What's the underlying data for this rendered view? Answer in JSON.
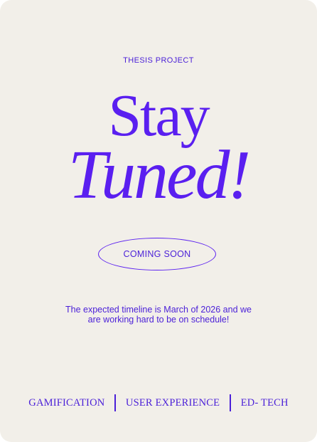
{
  "eyebrow": "THESIS PROJECT",
  "headline": {
    "line1": "Stay",
    "line2": "Tuned!"
  },
  "cta": {
    "label": "COMING SOON"
  },
  "body": {
    "line1": "The expected timeline is March of 2026 and we",
    "line2": "are working hard to be on schedule!"
  },
  "tags": [
    "GAMIFICATION",
    "USER EXPERIENCE",
    "ED- TECH"
  ],
  "colors": {
    "accent": "#5a1ff0",
    "text": "#4a1fd8",
    "card_bg": "#f2efe9"
  }
}
